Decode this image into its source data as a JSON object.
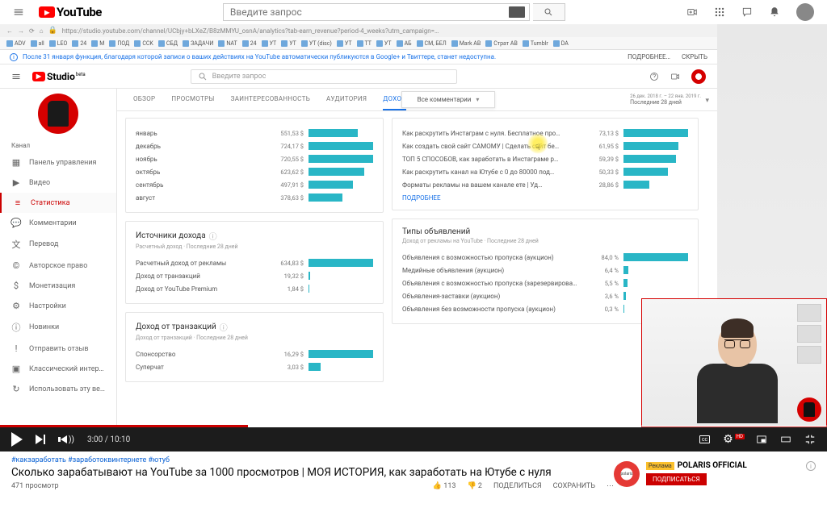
{
  "yt": {
    "brand": "YouTube",
    "search_placeholder": "Введите запрос",
    "icons": {
      "cam": "⏺",
      "apps": "▦",
      "msg": "💬",
      "bell": "🔔"
    }
  },
  "browser": {
    "url": "https://studio.youtube.com/channel/UCbjy+bLXeZ/B8zMMYU_osnA/analytics?tab-earn_revenue?period-4_weeks?utm_campaign=…",
    "bookmarks": [
      "ADV",
      "all",
      "LEO",
      "24",
      "М",
      "ПОД",
      "CCK",
      "СБД",
      "ЗАДАЧИ",
      "NAT",
      "24",
      "УТ",
      "УТ",
      "УТ (disc)",
      "УТ",
      "TT",
      "УТ",
      "АБ",
      "СМ, БЕЛ",
      "Mark АВ",
      "Страт АВ",
      "Tumblr",
      "DA"
    ]
  },
  "banner": {
    "text": "После 31 января функция, благодаря которой записи о ваших действиях на YouTube автоматически публикуются в Google+ и Твиттере, станет недоступна.",
    "more": "ПОДРОБНЕЕ…",
    "hide": "СКРЫТЬ"
  },
  "studio": {
    "brand": "Studio",
    "brand_beta": "beta",
    "search_placeholder": "Введите запрос"
  },
  "sidebar": {
    "section": "Канал",
    "items": [
      {
        "icon": "▦",
        "label": "Панель управления"
      },
      {
        "icon": "▶",
        "label": "Видео"
      },
      {
        "icon": "≡",
        "label": "Статистика",
        "active": true
      },
      {
        "icon": "💬",
        "label": "Комментарии"
      },
      {
        "icon": "文",
        "label": "Перевод"
      },
      {
        "icon": "©",
        "label": "Авторское право"
      },
      {
        "icon": "$",
        "label": "Монетизация"
      },
      {
        "icon": "⚙",
        "label": "Настройки"
      },
      {
        "icon": "ⓘ",
        "label": "Новинки"
      },
      {
        "icon": "!",
        "label": "Отправить отзыв"
      },
      {
        "icon": "▣",
        "label": "Классический интер…"
      },
      {
        "icon": "↻",
        "label": "Использовать эту ве…"
      }
    ]
  },
  "tabs": {
    "items": [
      "ОБЗОР",
      "ПРОСМОТРЫ",
      "ЗАИНТЕРЕСОВАННОСТЬ",
      "АУДИТОРИЯ",
      "ДОХОД"
    ],
    "active_index": 4,
    "popup": "Все комментарии",
    "date_range_small": "26 дек. 2018 г. – 22 янв. 2019 г.",
    "date_range": "Последние 28 дней"
  },
  "chart_data": {
    "months_panel": {
      "type": "bar",
      "currency": "$",
      "series": [
        {
          "label": "январь",
          "value": 551.53
        },
        {
          "label": "декабрь",
          "value": 724.17
        },
        {
          "label": "ноябрь",
          "value": 720.55
        },
        {
          "label": "октябрь",
          "value": 623.62
        },
        {
          "label": "сентябрь",
          "value": 497.91
        },
        {
          "label": "август",
          "value": 378.63
        }
      ],
      "max": 724.17
    },
    "sources_panel": {
      "title": "Источники дохода",
      "subtitle": "Расчетный доход · Последние 28 дней",
      "type": "bar",
      "currency": "$",
      "series": [
        {
          "label": "Расчетный доход от рекламы",
          "value": 634.83
        },
        {
          "label": "Доход от транзакций",
          "value": 19.32
        },
        {
          "label": "Доход от YouTube Premium",
          "value": 1.84
        }
      ],
      "max": 634.83
    },
    "transactions_panel": {
      "title": "Доход от транзакций",
      "subtitle": "Доход от транзакций · Последние 28 дней",
      "type": "bar",
      "currency": "$",
      "series": [
        {
          "label": "Спонсорство",
          "value": 16.29
        },
        {
          "label": "Суперчат",
          "value": 3.03
        }
      ],
      "max": 16.29
    },
    "videos_panel": {
      "type": "bar",
      "currency": "$",
      "series": [
        {
          "label": "Как раскрутить Инстаграм с нуля. Бесплатное про…",
          "value": 73.13
        },
        {
          "label": "Как создать свой сайт САМОМУ | Сделать сайт бе…",
          "value": 61.95
        },
        {
          "label": "ТОП 5 СПОСОБОВ, как заработать в Инстаграме р…",
          "value": 59.39
        },
        {
          "label": "Как раскрутить канал на Ютубе с 0 до 80000 под…",
          "value": 50.33
        },
        {
          "label": "Форматы рекламы на вашем канале ете | Уд…",
          "value": 28.86
        }
      ],
      "max": 73.13,
      "more": "ПОДРОБНЕЕ"
    },
    "adtypes_panel": {
      "title": "Типы объявлений",
      "subtitle": "Доход от рекламы на YouTube · Последние 28 дней",
      "type": "bar",
      "unit": "%",
      "series": [
        {
          "label": "Объявления с возможностью пропуска (аукцион)",
          "value": 84.0
        },
        {
          "label": "Медийные объявления (аукцион)",
          "value": 6.4
        },
        {
          "label": "Объявления с возможностью пропуска (зарезервирован…",
          "value": 5.5
        },
        {
          "label": "Объявления-заставки (аукцион)",
          "value": 3.6
        },
        {
          "label": "Объявления без возможности пропуска (аукцион)",
          "value": 0.3
        }
      ],
      "max": 84.0
    }
  },
  "player": {
    "current": "3:00",
    "duration": "10:10",
    "cc": "cc",
    "hd": "HD"
  },
  "video": {
    "hashtags": "#какзаработать #заработоквинтернете #ютуб",
    "title": "Сколько зарабатывают на YouTube за 1000 просмотров | МОЯ ИСТОРИЯ, как заработать на Ютубе с нуля",
    "views": "471 просмотр",
    "likes": "113",
    "dislikes": "2",
    "share": "ПОДЕЛИТЬСЯ",
    "save": "СОХРАНИТЬ"
  },
  "ad": {
    "badge": "Реклама",
    "title": "POLARIS OFFICIAL",
    "subscribe": "ПОДПИСАТЬСЯ",
    "logo_text": "polaris"
  }
}
